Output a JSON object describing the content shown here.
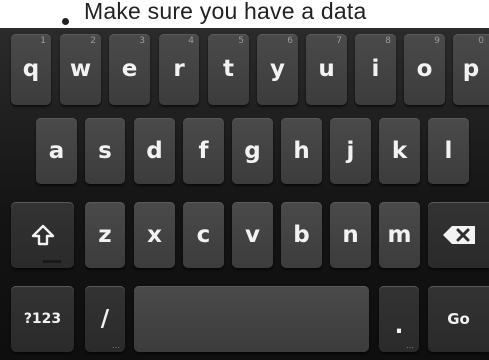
{
  "background": {
    "text": "Make sure you have a data"
  },
  "keyboard": {
    "row1": [
      {
        "label": "q",
        "hint": "1"
      },
      {
        "label": "w",
        "hint": "2"
      },
      {
        "label": "e",
        "hint": "3"
      },
      {
        "label": "r",
        "hint": "4"
      },
      {
        "label": "t",
        "hint": "5"
      },
      {
        "label": "y",
        "hint": "6"
      },
      {
        "label": "u",
        "hint": "7"
      },
      {
        "label": "i",
        "hint": "8"
      },
      {
        "label": "o",
        "hint": "9"
      },
      {
        "label": "p",
        "hint": "0"
      }
    ],
    "row2": [
      {
        "label": "a"
      },
      {
        "label": "s"
      },
      {
        "label": "d"
      },
      {
        "label": "f"
      },
      {
        "label": "g"
      },
      {
        "label": "h"
      },
      {
        "label": "j"
      },
      {
        "label": "k"
      },
      {
        "label": "l"
      }
    ],
    "row3": [
      {
        "label": "z"
      },
      {
        "label": "x"
      },
      {
        "label": "c"
      },
      {
        "label": "v"
      },
      {
        "label": "b"
      },
      {
        "label": "n"
      },
      {
        "label": "m"
      }
    ],
    "row4": {
      "symbols": "?123",
      "slash": "/",
      "period": ".",
      "go": "Go",
      "more_dots": "..."
    },
    "icons": {
      "shift": "shift-arrow-icon",
      "backspace": "backspace-icon"
    }
  }
}
